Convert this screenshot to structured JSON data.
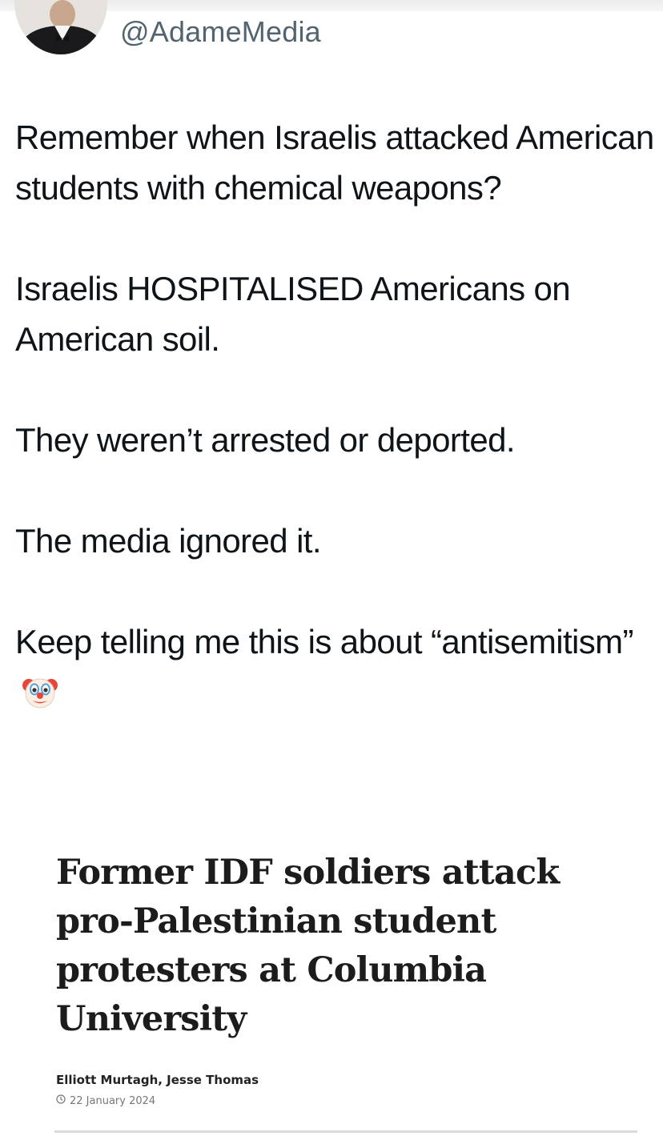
{
  "tweet": {
    "handle": "@AdameMedia",
    "paragraphs": [
      "Remember when Israelis attacked American students with chemical weapons?",
      "Israelis HOSPITALISED Americans on American soil.",
      "They weren’t arrested or deported.",
      "The media ignored it."
    ],
    "closing_line": "Keep telling me this is about “antisemitism”",
    "emoji": "clown-face-emoji"
  },
  "article": {
    "headline": "Former IDF soldiers attack pro-Palestinian student protesters at Columbia University",
    "authors": "Elliott Murtagh, Jesse Thomas",
    "date": "22 January 2024"
  }
}
